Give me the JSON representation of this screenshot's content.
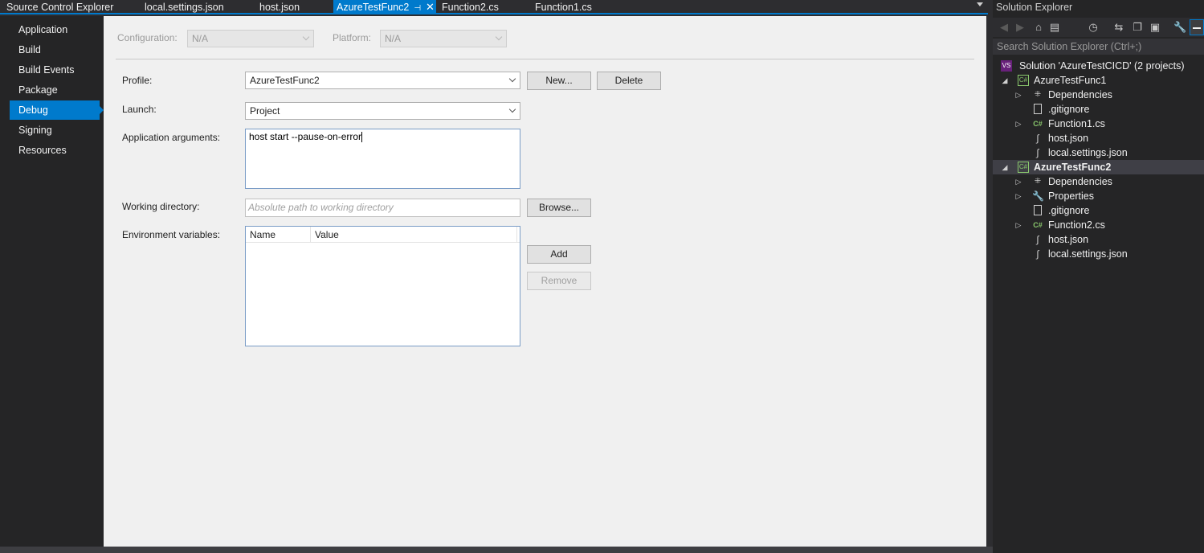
{
  "tabs": [
    {
      "label": "Source Control Explorer"
    },
    {
      "label": "local.settings.json"
    },
    {
      "label": "host.json"
    },
    {
      "label": "AzureTestFunc2"
    },
    {
      "label": "Function2.cs"
    },
    {
      "label": "Function1.cs"
    }
  ],
  "nav": {
    "items": [
      "Application",
      "Build",
      "Build Events",
      "Package",
      "Debug",
      "Signing",
      "Resources"
    ],
    "selected": "Debug"
  },
  "config": {
    "configuration_label": "Configuration:",
    "configuration_value": "N/A",
    "platform_label": "Platform:",
    "platform_value": "N/A"
  },
  "debug": {
    "profile_label": "Profile:",
    "profile_value": "AzureTestFunc2",
    "new_button": "New...",
    "delete_button": "Delete",
    "launch_label": "Launch:",
    "launch_value": "Project",
    "app_args_label": "Application arguments:",
    "app_args_value": "host start --pause-on-error",
    "workdir_label": "Working directory:",
    "workdir_placeholder": "Absolute path to working directory",
    "browse_button": "Browse...",
    "envvars_label": "Environment variables:",
    "env_columns": [
      "Name",
      "Value"
    ],
    "add_button": "Add",
    "remove_button": "Remove"
  },
  "solution_explorer": {
    "title": "Solution Explorer",
    "search_placeholder": "Search Solution Explorer (Ctrl+;)",
    "tree": [
      {
        "label": "Solution 'AzureTestCICD' (2 projects)",
        "icon": "solution-icon"
      },
      {
        "label": "AzureTestFunc1",
        "icon": "csharp-project-icon"
      },
      {
        "label": "Dependencies",
        "icon": "dependencies-icon"
      },
      {
        "label": ".gitignore",
        "icon": "file-icon"
      },
      {
        "label": "Function1.cs",
        "icon": "csharp-file-icon"
      },
      {
        "label": "host.json",
        "icon": "json-file-icon"
      },
      {
        "label": "local.settings.json",
        "icon": "json-file-icon"
      },
      {
        "label": "AzureTestFunc2",
        "icon": "csharp-project-icon"
      },
      {
        "label": "Dependencies",
        "icon": "dependencies-icon"
      },
      {
        "label": "Properties",
        "icon": "wrench-icon"
      },
      {
        "label": ".gitignore",
        "icon": "file-icon"
      },
      {
        "label": "Function2.cs",
        "icon": "csharp-file-icon"
      },
      {
        "label": "host.json",
        "icon": "json-file-icon"
      },
      {
        "label": "local.settings.json",
        "icon": "json-file-icon"
      }
    ]
  },
  "colors": {
    "accent": "#007acc",
    "page_bg": "#f0f0f0",
    "dark_bg": "#252526"
  }
}
